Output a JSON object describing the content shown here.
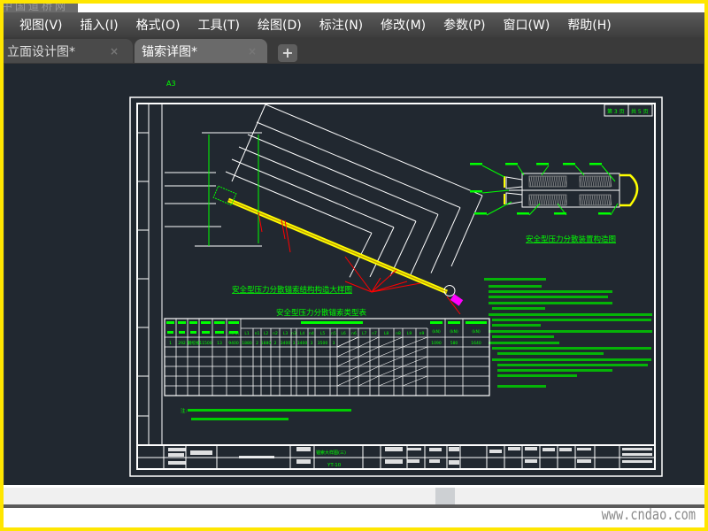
{
  "watermark": "中国道桥网",
  "menu": [
    "视图(V)",
    "插入(I)",
    "格式(O)",
    "工具(T)",
    "绘图(D)",
    "标注(N)",
    "修改(M)",
    "参数(P)",
    "窗口(W)",
    "帮助(H)"
  ],
  "tabs": [
    {
      "label": "立面设计图*",
      "active": false
    },
    {
      "label": "锚索详图*",
      "active": true
    }
  ],
  "add_tab": "+",
  "close_glyph": "×",
  "sheet": {
    "size_label": "A3",
    "page_current": "第 3 页",
    "page_total": "共 5 页",
    "main_title": "安全型压力分散锚索结构构造大样图",
    "device_title": "安全型压力分散装置构造图",
    "table_title": "安全型压力分散锚索类型表",
    "table": {
      "headers": [
        "L1",
        "n1",
        "L2",
        "n2",
        "L3",
        "n3",
        "L4",
        "n4",
        "L5",
        "n5",
        "L6",
        "n6",
        "L7",
        "n7",
        "L8",
        "n8",
        "L9",
        "n9"
      ],
      "unit_mpa": "(MPa)",
      "unit_kn": [
        "(kN)",
        "(kN)",
        "(kN)"
      ],
      "row": [
        "1",
        "292",
        "钢绞线",
        "11500",
        "13",
        "9400",
        "1880",
        "2",
        "1880",
        "2",
        "3400",
        "3",
        "3400",
        "3",
        "3500",
        "3",
        "1090",
        "580",
        "1640"
      ]
    },
    "note_label": "注:",
    "title_block": {
      "drawing_name": "锚索大样图(三)",
      "drawing_no": "YT-10"
    }
  },
  "colors": {
    "canvas": "#212830",
    "line": "#ffffff",
    "text": "#00ff00",
    "anchor": "#ffff00",
    "red": "#ff0000",
    "magenta": "#ff00ff"
  },
  "footer_site": "www.cndao.com"
}
